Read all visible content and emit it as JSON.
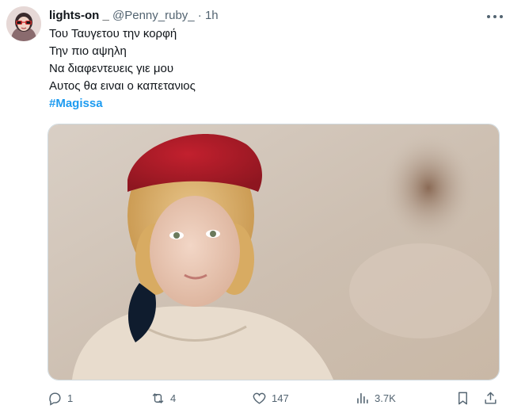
{
  "tweet": {
    "author": {
      "display_name": "lights-on _",
      "handle": "@Penny_ruby_",
      "separator": "·",
      "timestamp": "1h",
      "avatar_icon": "avatar-woman-red-glasses"
    },
    "lines": [
      "Του Ταυγετου την κορφή",
      "Την πιο αψηλη",
      "Να διαφεντευεις γιε μου",
      "Αυτος θα ειναι ο καπετανιος"
    ],
    "hashtag": "#Magissa",
    "media_icon": "photo-child-red-fez",
    "metrics": {
      "replies": "1",
      "retweets": "4",
      "likes": "147",
      "views": "3.7K"
    },
    "icons": {
      "reply": "reply-icon",
      "retweet": "retweet-icon",
      "like": "heart-icon",
      "views": "views-icon",
      "bookmark": "bookmark-icon",
      "share": "share-icon",
      "more": "more-icon"
    },
    "colors": {
      "text": "#0f1419",
      "secondary": "#536471",
      "hashtag": "#1d9bf0"
    }
  }
}
